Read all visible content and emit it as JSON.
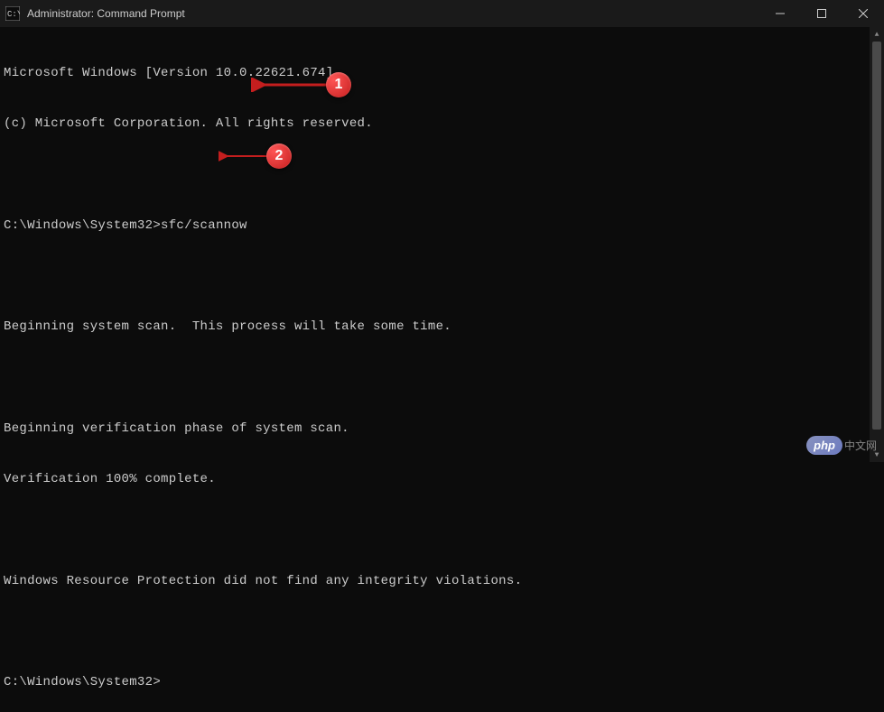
{
  "titlebar": {
    "title": "Administrator: Command Prompt",
    "icon": "cmd-icon"
  },
  "terminal": {
    "line1": "Microsoft Windows [Version 10.0.22621.674]",
    "line2": "(c) Microsoft Corporation. All rights reserved.",
    "line3": "",
    "line4_prompt": "C:\\Windows\\System32>",
    "line4_cmd": "sfc/scannow",
    "line5": "",
    "line6": "Beginning system scan.  This process will take some time.",
    "line7": "",
    "line8": "Beginning verification phase of system scan.",
    "line9": "Verification 100% complete.",
    "line10": "",
    "line11": "Windows Resource Protection did not find any integrity violations.",
    "line12": "",
    "line13_prompt": "C:\\Windows\\System32>"
  },
  "annotations": {
    "badge1": "1",
    "badge2": "2"
  },
  "watermark": {
    "logo": "php",
    "text": "中文网"
  }
}
